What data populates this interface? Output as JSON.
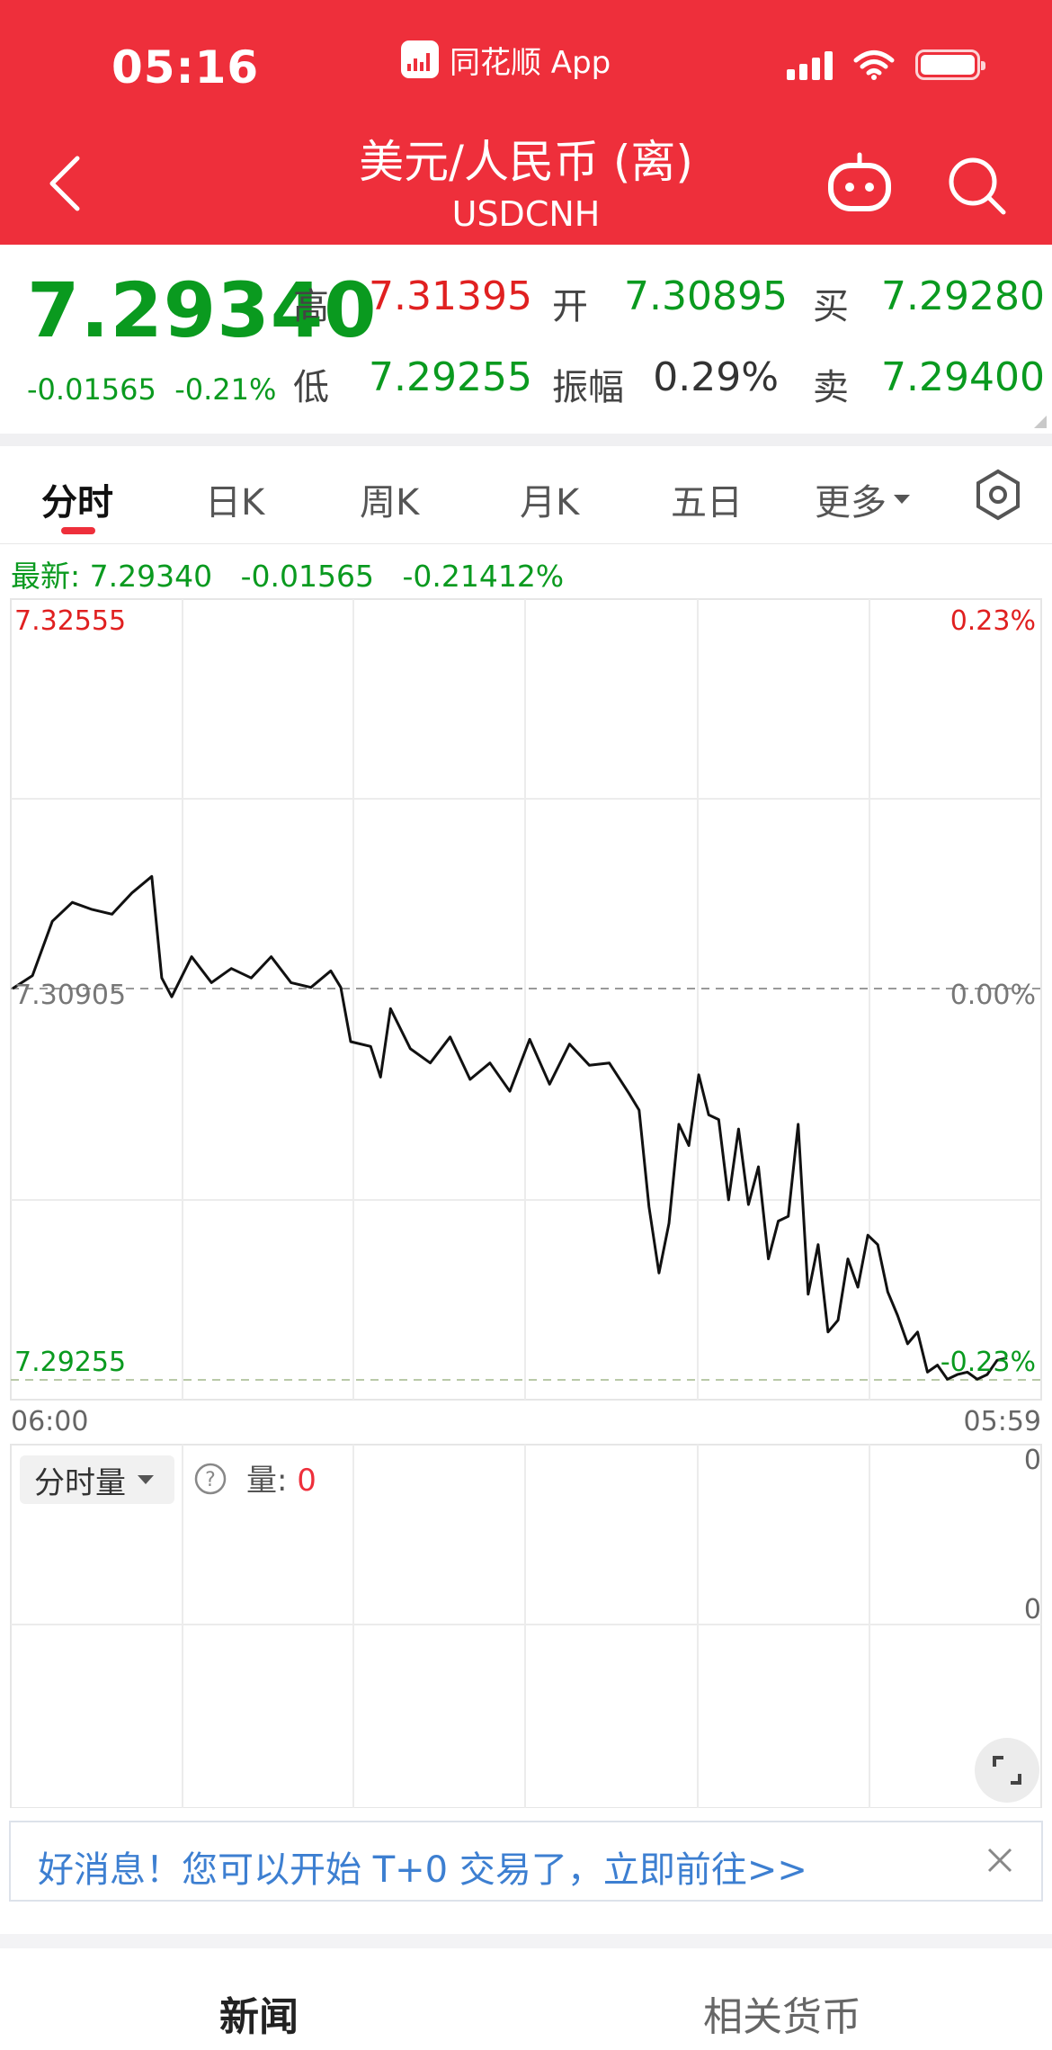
{
  "status": {
    "time": "05:16",
    "app_name": "同花顺 App"
  },
  "header": {
    "title": "美元/人民币 (离)",
    "subtitle": "USDCNH"
  },
  "quote": {
    "price": "7.29340",
    "change": "-0.01565",
    "change_pct": "-0.21%",
    "high_label": "高",
    "high": "7.31395",
    "low_label": "低",
    "low": "7.29255",
    "open_label": "开",
    "open": "7.30895",
    "amp_label": "振幅",
    "amplitude": "0.29%",
    "buy_label": "买",
    "buy": "7.29280",
    "sell_label": "卖",
    "sell": "7.29400",
    "colors": {
      "up": "#e02020",
      "down": "#0a9a1f"
    }
  },
  "tabs": [
    "分时",
    "日K",
    "周K",
    "月K",
    "五日",
    "更多"
  ],
  "latest_line": {
    "label": "最新:",
    "price": "7.29340",
    "change": "-0.01565",
    "pct": "-0.21412%"
  },
  "chart_data": {
    "type": "line",
    "title": "",
    "xlabel": "",
    "ylabel": "",
    "ylim": [
      7.29255,
      7.32555
    ],
    "y_top_label": "7.32555",
    "y_mid_label": "7.30905",
    "y_bottom_label": "7.29255",
    "pct_top_label": "0.23%",
    "pct_mid_label": "0.00%",
    "pct_bottom_label": "-0.23%",
    "x_start_label": "06:00",
    "x_end_label": "05:59",
    "reference_price": 7.30905,
    "x": [
      0.0,
      0.02,
      0.04,
      0.06,
      0.08,
      0.1,
      0.12,
      0.14,
      0.15,
      0.16,
      0.18,
      0.2,
      0.22,
      0.24,
      0.26,
      0.28,
      0.3,
      0.32,
      0.33,
      0.34,
      0.36,
      0.37,
      0.38,
      0.4,
      0.42,
      0.44,
      0.46,
      0.48,
      0.5,
      0.52,
      0.54,
      0.56,
      0.58,
      0.6,
      0.62,
      0.63,
      0.64,
      0.65,
      0.66,
      0.67,
      0.68,
      0.69,
      0.7,
      0.71,
      0.72,
      0.73,
      0.74,
      0.75,
      0.76,
      0.77,
      0.78,
      0.79,
      0.8,
      0.81,
      0.82,
      0.83,
      0.84,
      0.85,
      0.86,
      0.87,
      0.88,
      0.89,
      0.9,
      0.91,
      0.92,
      0.93,
      0.94,
      0.95,
      0.96,
      0.97,
      0.98,
      0.99,
      1.0
    ],
    "values": [
      7.30905,
      7.3096,
      7.3119,
      7.3127,
      7.3124,
      7.3122,
      7.3131,
      7.3138,
      7.3095,
      7.3087,
      7.3104,
      7.3093,
      7.3099,
      7.3095,
      7.3104,
      7.3093,
      7.3091,
      7.3098,
      7.3091,
      7.3068,
      7.3066,
      7.3053,
      7.3082,
      7.3065,
      7.3059,
      7.307,
      7.3052,
      7.3059,
      7.3047,
      7.3069,
      7.305,
      7.3067,
      7.3058,
      7.3059,
      7.3046,
      7.3039,
      7.2998,
      7.297,
      7.2991,
      7.3033,
      7.3024,
      7.3054,
      7.3037,
      7.3035,
      7.3001,
      7.3031,
      7.2999,
      7.3015,
      7.2976,
      7.2992,
      7.2994,
      7.3033,
      7.2961,
      7.2982,
      7.2945,
      7.295,
      7.2976,
      7.2964,
      7.2986,
      7.2982,
      7.2962,
      7.2952,
      7.294,
      7.2945,
      7.2928,
      7.2931,
      7.2925,
      7.2927,
      7.2928,
      7.2925,
      7.2927,
      7.2933,
      7.2934
    ]
  },
  "volume": {
    "select_label": "分时量",
    "label": "量:",
    "value": "0",
    "axis_top": "0",
    "axis_mid": "0"
  },
  "banner": {
    "text": "好消息！您可以开始 T+0 交易了，立即前往>>"
  },
  "bottom_tabs": [
    "新闻",
    "相关货币"
  ]
}
